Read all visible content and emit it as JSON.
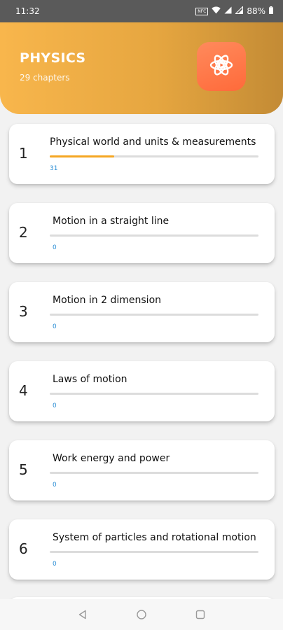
{
  "status_bar": {
    "time": "11:32",
    "nfc_label": "NFC",
    "battery": "88%",
    "icons": [
      "wifi-icon",
      "signal-icon",
      "signal-icon",
      "battery-icon"
    ]
  },
  "header": {
    "title": "PHYSICS",
    "subtitle": "29 chapters",
    "badge_icon": "atom-icon",
    "gradient_start": "#f8b64c",
    "gradient_end": "#c38b35",
    "badge_color": "#ff7043"
  },
  "chapters": [
    {
      "number": "1",
      "title": "Physical world and units & measurements",
      "progress_label": "31",
      "progress": 0.31
    },
    {
      "number": "2",
      "title": "Motion in a straight line",
      "progress_label": "0",
      "progress": 0
    },
    {
      "number": "3",
      "title": "Motion in 2 dimension",
      "progress_label": "0",
      "progress": 0
    },
    {
      "number": "4",
      "title": "Laws of motion",
      "progress_label": "0",
      "progress": 0
    },
    {
      "number": "5",
      "title": "Work energy and power",
      "progress_label": "0",
      "progress": 0
    },
    {
      "number": "6",
      "title": "System of particles and rotational motion",
      "progress_label": "0",
      "progress": 0
    }
  ],
  "colors": {
    "progress_fill": "#f5a623",
    "progress_track": "#dcdcdc",
    "progress_text": "#2d8fd5"
  },
  "nav_bar": {
    "icons": [
      "back-icon",
      "home-icon",
      "recents-icon"
    ]
  }
}
